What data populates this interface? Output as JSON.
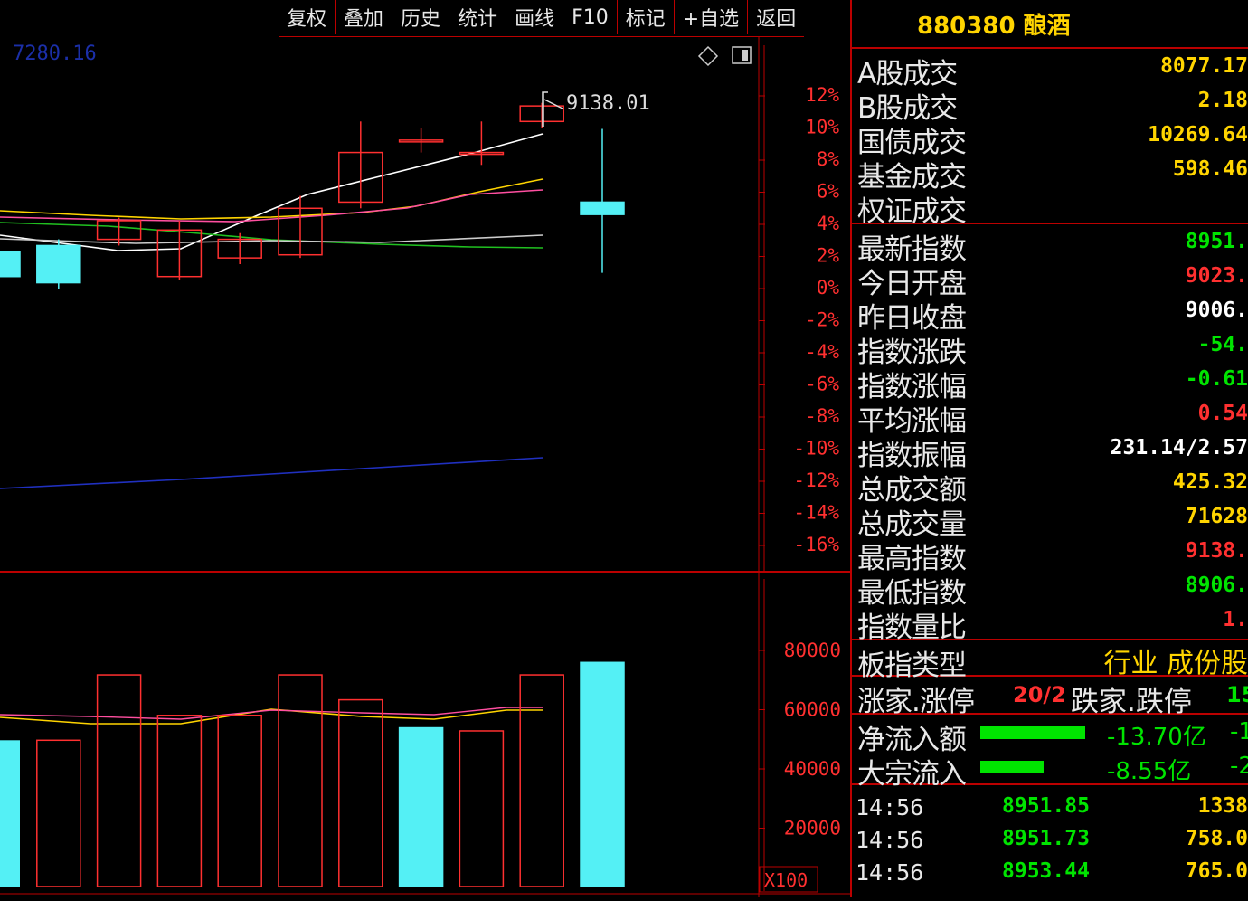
{
  "toolbar": {
    "items": [
      "复权",
      "叠加",
      "历史",
      "统计",
      "画线",
      "F10",
      "标记",
      "+自选",
      "返回"
    ]
  },
  "chart": {
    "top_left_value": "7280.16",
    "high_marker": "9138.01",
    "pct_ticks": [
      "12%",
      "10%",
      "8%",
      "6%",
      "4%",
      "2%",
      "0%",
      "-2%",
      "-4%",
      "-6%",
      "-8%",
      "-10%",
      "-12%",
      "-14%",
      "-16%"
    ],
    "vol_ticks": [
      "80000",
      "60000",
      "40000",
      "20000"
    ],
    "vol_unit": "X100"
  },
  "sidebar": {
    "title": "880380 酿酒",
    "trade_rows": [
      {
        "label": "A股成交",
        "value": "8077.17",
        "color": "#ffd400"
      },
      {
        "label": "B股成交",
        "value": "2.18",
        "color": "#ffd400"
      },
      {
        "label": "国债成交",
        "value": "10269.64",
        "color": "#ffd400"
      },
      {
        "label": "基金成交",
        "value": "598.46",
        "color": "#ffd400"
      },
      {
        "label": "权证成交",
        "value": "",
        "color": "#ffd400"
      }
    ],
    "index_rows": [
      {
        "label": "最新指数",
        "value": "8951.",
        "color": "#00e400"
      },
      {
        "label": "今日开盘",
        "value": "9023.",
        "color": "#ff3030"
      },
      {
        "label": "昨日收盘",
        "value": "9006.",
        "color": "#ffffff"
      },
      {
        "label": "指数涨跌",
        "value": "-54.",
        "color": "#00e400"
      },
      {
        "label": "指数涨幅",
        "value": "-0.61",
        "color": "#00e400"
      },
      {
        "label": "平均涨幅",
        "value": "0.54",
        "color": "#ff3030"
      },
      {
        "label": "指数振幅",
        "value": "231.14/2.57",
        "color": "#ffffff"
      },
      {
        "label": "总成交额",
        "value": "425.32",
        "color": "#ffd400"
      },
      {
        "label": "总成交量",
        "value": "71628",
        "color": "#ffd400"
      },
      {
        "label": "最高指数",
        "value": "9138.",
        "color": "#ff3030"
      },
      {
        "label": "最低指数",
        "value": "8906.",
        "color": "#00e400"
      },
      {
        "label": "指数量比",
        "value": "1.",
        "color": "#ff3030"
      }
    ],
    "board_type": {
      "label": "板指类型",
      "value": "行业 成份股"
    },
    "updown": {
      "up_label": "涨家.涨停",
      "up_value": "20/2",
      "down_label": "跌家.跌停",
      "down_value": "15"
    },
    "flows": [
      {
        "label": "净流入额",
        "value": "-13.70亿",
        "extra": "-1",
        "bar_fraction": 1.0
      },
      {
        "label": "大宗流入",
        "value": "-8.55亿",
        "extra": "-2",
        "bar_fraction": 0.6
      }
    ],
    "ticks": [
      {
        "time": "14:56",
        "price": "8951.85",
        "vol": "1338"
      },
      {
        "time": "14:56",
        "price": "8951.73",
        "vol": "758.0"
      },
      {
        "time": "14:56",
        "price": "8953.44",
        "vol": "765.0"
      }
    ],
    "colors": {
      "up": "#ff3030",
      "down": "#00e400",
      "cyan": "#54f0f5",
      "yellow": "#ffd400"
    }
  },
  "chart_data": {
    "type": "candlestick",
    "open": [
      8940,
      8950,
      8960,
      8900,
      8930,
      8935,
      9020,
      9120,
      9100,
      9150,
      9020
    ],
    "close": [
      8900,
      8890,
      8990,
      8975,
      8960,
      9010,
      9100,
      9120,
      9100,
      9175,
      9000
    ],
    "high": [
      8960,
      8960,
      8995,
      8990,
      8970,
      9030,
      9150,
      9140,
      9150,
      9180,
      9138
    ],
    "low": [
      8880,
      8880,
      8950,
      8895,
      8920,
      8930,
      9010,
      9100,
      9080,
      9140,
      8906
    ],
    "volume": [
      47000,
      68000,
      55000,
      55000,
      68000,
      60000,
      51000,
      50000,
      68000,
      72000
    ],
    "y_axis_pct": [
      12,
      -16
    ],
    "vol_axis": [
      0,
      80000
    ]
  }
}
